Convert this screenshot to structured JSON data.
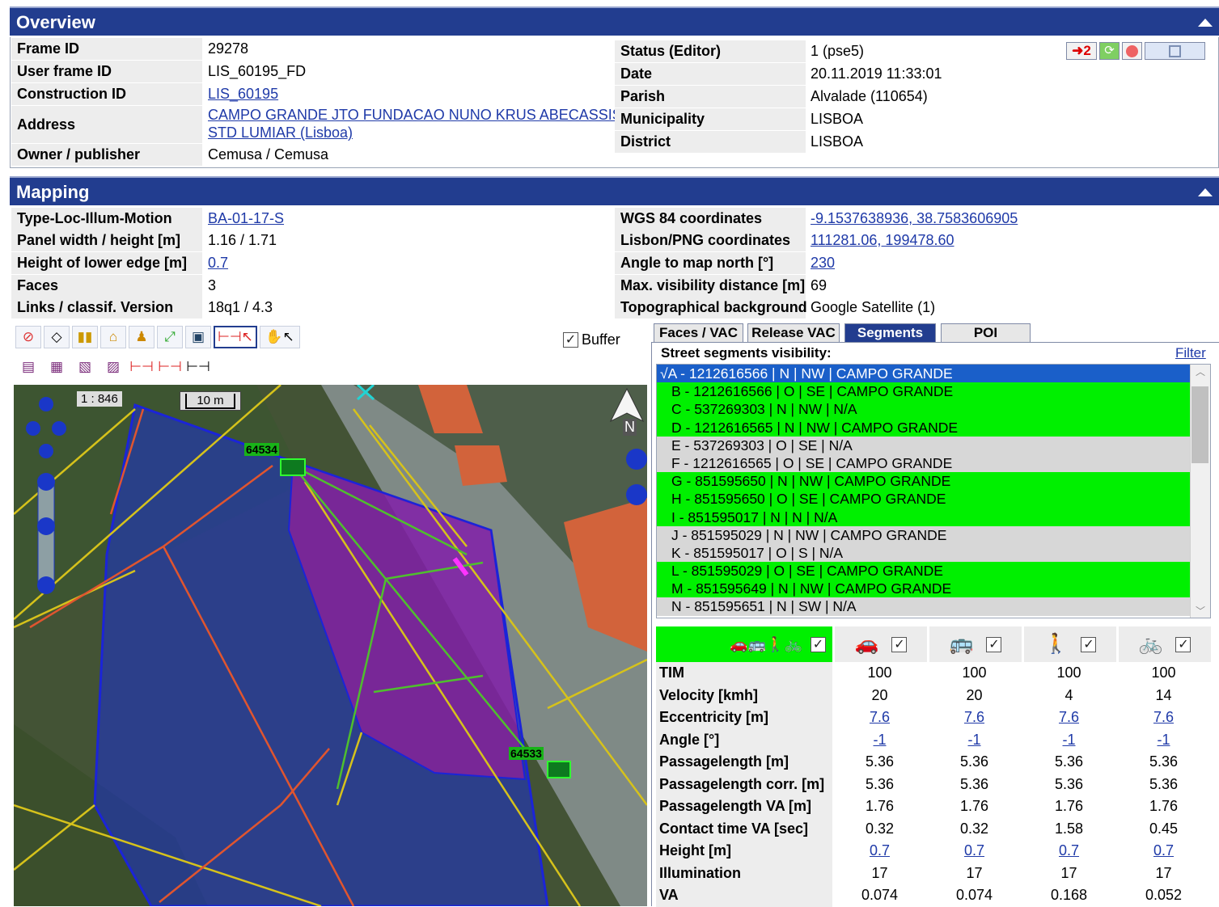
{
  "overview": {
    "title": "Overview",
    "left": [
      {
        "label": "Frame ID",
        "value": "29278"
      },
      {
        "label": "User frame ID",
        "value": "LIS_60195_FD"
      },
      {
        "label": "Construction ID",
        "value": "LIS_60195"
      },
      {
        "label": "Address",
        "value_line1": "CAMPO GRANDE JTO FUNDACAO NUNO KRUS ABECASSIS",
        "value_line2": "STD LUMIAR (Lisboa)"
      },
      {
        "label": "Owner / publisher",
        "value": "Cemusa / Cemusa"
      }
    ],
    "right": [
      {
        "label": "Status (Editor)",
        "value": "1   (pse5)"
      },
      {
        "label": "Date",
        "value": "20.11.2019 11:33:01"
      },
      {
        "label": "Parish",
        "value": "Alvalade (110654)"
      },
      {
        "label": "Municipality",
        "value": "LISBOA"
      },
      {
        "label": "District",
        "value": "LISBOA"
      }
    ],
    "badge_count": "2"
  },
  "mapping": {
    "title": "Mapping",
    "left": [
      {
        "label": "Type-Loc-Illum-Motion",
        "value": "BA-01-17-S"
      },
      {
        "label": "Panel width / height [m]",
        "value": "1.16 / 1.71"
      },
      {
        "label": "Height of lower edge [m]",
        "value": "0.7"
      },
      {
        "label": "Faces",
        "value": "3"
      },
      {
        "label": "Links / classif. Version",
        "value": "18q1 / 4.3"
      }
    ],
    "right": [
      {
        "label": "WGS 84 coordinates",
        "value": "-9.1537638936, 38.7583606905"
      },
      {
        "label": "Lisbon/PNG coordinates",
        "value": "111281.06, 199478.60"
      },
      {
        "label": "Angle to map north [°]",
        "value": "230"
      },
      {
        "label": "Max. visibility distance [m]",
        "value": "69"
      },
      {
        "label": "Topographical background",
        "value": "Google Satellite (1)"
      }
    ],
    "buffer_label": "Buffer"
  },
  "map": {
    "scale_text": "1 : 846",
    "scalebar_text": "10 m",
    "north_label": "N",
    "panel_labels": [
      "64534",
      "64533"
    ]
  },
  "tabs": [
    "Faces / VAC",
    "Release VAC",
    "Segments",
    "POI"
  ],
  "segments": {
    "heading": "Street segments visibility:",
    "filter_label": "Filter",
    "items": [
      {
        "text": "√A - 1212616566 | N | NW | CAMPO GRANDE",
        "state": "sel"
      },
      {
        "text": "B - 1212616566 | O | SE | CAMPO GRANDE",
        "state": "green"
      },
      {
        "text": "C - 537269303 | N | NW | N/A",
        "state": "green"
      },
      {
        "text": "D - 1212616565 | N | NW | CAMPO GRANDE",
        "state": "green"
      },
      {
        "text": "E - 537269303 | O | SE | N/A",
        "state": "grey"
      },
      {
        "text": "F - 1212616565 | O | SE | CAMPO GRANDE",
        "state": "grey"
      },
      {
        "text": "G - 851595650 | N | NW | CAMPO GRANDE",
        "state": "green"
      },
      {
        "text": "H - 851595650 | O | SE | CAMPO GRANDE",
        "state": "green"
      },
      {
        "text": "I - 851595017 | N | N | N/A",
        "state": "green"
      },
      {
        "text": "J - 851595029 | N | NW | CAMPO GRANDE",
        "state": "grey"
      },
      {
        "text": "K - 851595017 | O | S | N/A",
        "state": "grey"
      },
      {
        "text": "L - 851595029 | O | SE | CAMPO GRANDE",
        "state": "green"
      },
      {
        "text": "M - 851595649 | N | NW | CAMPO GRANDE",
        "state": "green"
      },
      {
        "text": "N - 851595651 | N | SW | N/A",
        "state": "grey"
      }
    ]
  },
  "metrics": {
    "rows": [
      {
        "label": "TIM",
        "values": [
          "100",
          "100",
          "100",
          "100"
        ],
        "link": false
      },
      {
        "label": "Velocity [kmh]",
        "values": [
          "20",
          "20",
          "4",
          "14"
        ],
        "link": false
      },
      {
        "label": "Eccentricity [m]",
        "values": [
          "7.6",
          "7.6",
          "7.6",
          "7.6"
        ],
        "link": true
      },
      {
        "label": "Angle [°]",
        "values": [
          "-1",
          "-1",
          "-1",
          "-1"
        ],
        "link": true
      },
      {
        "label": "Passagelength [m]",
        "values": [
          "5.36",
          "5.36",
          "5.36",
          "5.36"
        ],
        "link": false
      },
      {
        "label": "Passagelength corr. [m]",
        "values": [
          "5.36",
          "5.36",
          "5.36",
          "5.36"
        ],
        "link": false
      },
      {
        "label": "Passagelength VA [m]",
        "values": [
          "1.76",
          "1.76",
          "1.76",
          "1.76"
        ],
        "link": false
      },
      {
        "label": "Contact time VA [sec]",
        "values": [
          "0.32",
          "0.32",
          "1.58",
          "0.45"
        ],
        "link": false
      },
      {
        "label": "Height [m]",
        "values": [
          "0.7",
          "0.7",
          "0.7",
          "0.7"
        ],
        "link": true
      },
      {
        "label": "Illumination",
        "values": [
          "17",
          "17",
          "17",
          "17"
        ],
        "link": false
      },
      {
        "label": "VA",
        "values": [
          "0.074",
          "0.074",
          "0.168",
          "0.052"
        ],
        "link": false
      }
    ]
  },
  "colors": {
    "header_bg": "#223d8f",
    "segment_green": "#00f000",
    "segment_grey": "#d7d7d7",
    "selected": "#1a5fc9"
  }
}
